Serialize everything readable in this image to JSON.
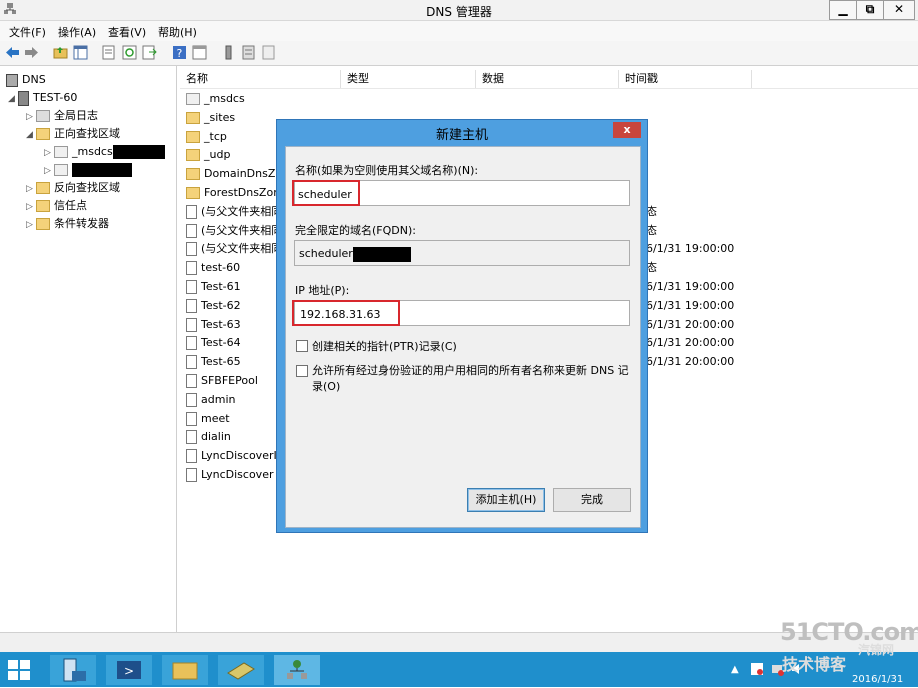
{
  "window": {
    "title": "DNS 管理器",
    "minimize": "▁",
    "restore": "⧉",
    "close": "✕"
  },
  "menu": [
    "文件(F)",
    "操作(A)",
    "查看(V)",
    "帮助(H)"
  ],
  "toolbar_icons": [
    "back-arrow-icon",
    "forward-arrow-icon",
    "folder-up-icon",
    "show-tree-icon",
    "properties-icon",
    "refresh-icon",
    "export-icon",
    "help-icon",
    "view-icon",
    "server-icon",
    "list-icon",
    "new-icon"
  ],
  "tree": [
    {
      "label": "DNS",
      "indent": 0,
      "arrow": "",
      "icon": "dns"
    },
    {
      "label": "TEST-60",
      "indent": 1,
      "arrow": "◢",
      "icon": "server"
    },
    {
      "label": "全局日志",
      "indent": 2,
      "arrow": "▷",
      "icon": "log"
    },
    {
      "label": "正向查找区域",
      "indent": 2,
      "arrow": "◢",
      "icon": "folder"
    },
    {
      "label": "_msdcs",
      "indent": 3,
      "arrow": "▷",
      "icon": "zone",
      "redacted": true
    },
    {
      "label": "",
      "indent": 3,
      "arrow": "▷",
      "icon": "zone",
      "redacted": true
    },
    {
      "label": "反向查找区域",
      "indent": 2,
      "arrow": "▷",
      "icon": "folder"
    },
    {
      "label": "信任点",
      "indent": 2,
      "arrow": "▷",
      "icon": "folder"
    },
    {
      "label": "条件转发器",
      "indent": 2,
      "arrow": "▷",
      "icon": "folder"
    }
  ],
  "columns": [
    "名称",
    "类型",
    "数据",
    "时间戳"
  ],
  "records": [
    {
      "name": "_msdcs",
      "icon": "zone",
      "ts": ""
    },
    {
      "name": "_sites",
      "icon": "folder",
      "ts": ""
    },
    {
      "name": "_tcp",
      "icon": "folder",
      "ts": ""
    },
    {
      "name": "_udp",
      "icon": "folder",
      "ts": ""
    },
    {
      "name": "DomainDnsZo",
      "icon": "folder",
      "ts": ""
    },
    {
      "name": "ForestDnsZone",
      "icon": "folder",
      "ts": ""
    },
    {
      "name": "(与父文件夹相同",
      "icon": "doc",
      "ts": "态"
    },
    {
      "name": "(与父文件夹相同",
      "icon": "doc",
      "ts": "态"
    },
    {
      "name": "(与父文件夹相同",
      "icon": "doc",
      "ts": "6/1/31 19:00:00"
    },
    {
      "name": "test-60",
      "icon": "doc",
      "ts": "态"
    },
    {
      "name": "Test-61",
      "icon": "doc",
      "ts": "6/1/31 19:00:00"
    },
    {
      "name": "Test-62",
      "icon": "doc",
      "ts": "6/1/31 19:00:00"
    },
    {
      "name": "Test-63",
      "icon": "doc",
      "ts": "6/1/31 20:00:00"
    },
    {
      "name": "Test-64",
      "icon": "doc",
      "ts": "6/1/31 20:00:00"
    },
    {
      "name": "Test-65",
      "icon": "doc",
      "ts": "6/1/31 20:00:00"
    },
    {
      "name": "SFBFEPool",
      "icon": "doc",
      "ts": ""
    },
    {
      "name": "admin",
      "icon": "doc",
      "ts": ""
    },
    {
      "name": "meet",
      "icon": "doc",
      "ts": ""
    },
    {
      "name": "dialin",
      "icon": "doc",
      "ts": ""
    },
    {
      "name": "LyncDiscoverIr",
      "icon": "doc",
      "ts": ""
    },
    {
      "name": "LyncDiscover",
      "icon": "doc",
      "ts": ""
    }
  ],
  "dialog": {
    "title": "新建主机",
    "close": "x",
    "name_label": "名称(如果为空则使用其父域名称)(N):",
    "name_value": "scheduler",
    "fqdn_label": "完全限定的域名(FQDN):",
    "fqdn_value": "scheduler",
    "ip_label": "IP 地址(P):",
    "ip_value": "192.168.31.63",
    "ptr_label": "创建相关的指针(PTR)记录(C)",
    "ptr_checked": false,
    "allow_label_1": "允许所有经过身份验证的用户用相同的所有者名称来更新 DNS 记",
    "allow_label_2": "录(O)",
    "allow_checked": false,
    "add_button": "添加主机(H)",
    "done_button": "完成"
  },
  "taskbar": {
    "apps": [
      "start-icon",
      "server-manager-icon",
      "powershell-icon",
      "file-explorer-icon",
      "tools-icon",
      "dns-manager-icon"
    ],
    "active_app": "dns-manager-icon",
    "tray_expand": "▲",
    "date": "2016/1/31"
  },
  "watermark": {
    "line1": "51CTO.com",
    "line2": "技术博客",
    "line3": "Blog",
    "line4": "汽锦网",
    "line5": "qiyuny.com"
  },
  "colors": {
    "accent": "#4e9fe0",
    "taskbar": "#1f8fcc",
    "highlight": "#d8272d"
  }
}
